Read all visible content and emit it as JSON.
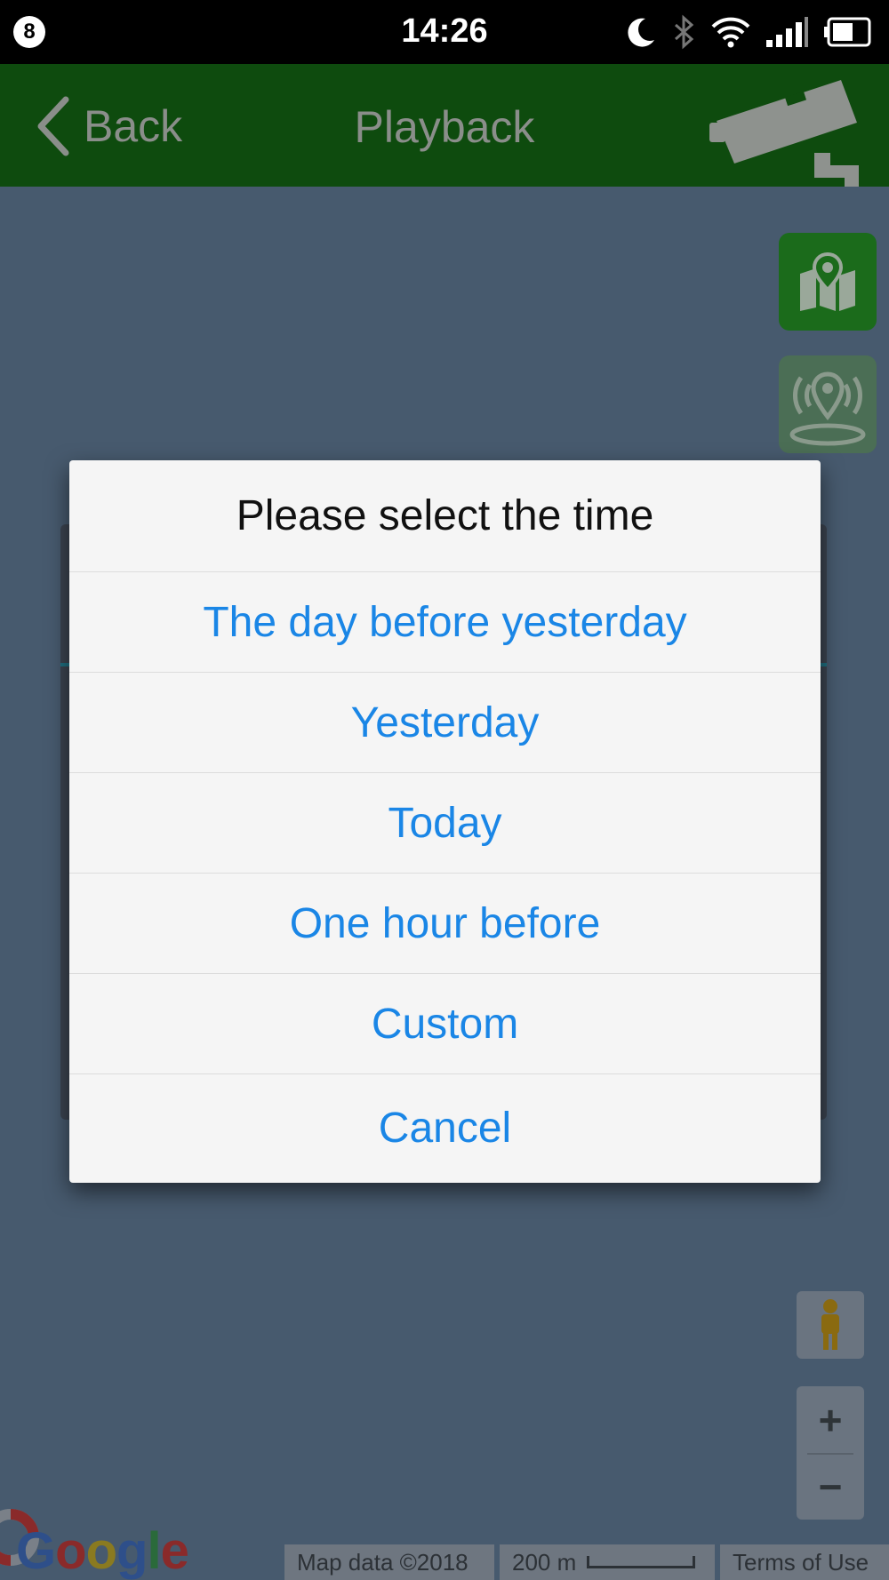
{
  "status_bar": {
    "notification_count": "8",
    "time": "14:26",
    "icons": [
      "moon-icon",
      "bluetooth-icon",
      "wifi-icon",
      "cell-signal-icon",
      "battery-icon"
    ]
  },
  "header": {
    "back_label": "Back",
    "title": "Playback",
    "background_color": "#0e4b0e",
    "icon": "cctv-camera-icon"
  },
  "map": {
    "side_buttons": [
      "map-icon",
      "location-signal-icon"
    ],
    "zoom_in": "+",
    "zoom_out": "−",
    "google_logo": "Google",
    "footer": {
      "map_data": "Map data ©2018",
      "scale": "200 m",
      "terms": "Terms of Use"
    }
  },
  "dialog": {
    "title": "Please select the time",
    "options": [
      "The day before yesterday",
      "Yesterday",
      "Today",
      "One hour before",
      "Custom",
      "Cancel"
    ],
    "option_color": "#1a86e6"
  }
}
